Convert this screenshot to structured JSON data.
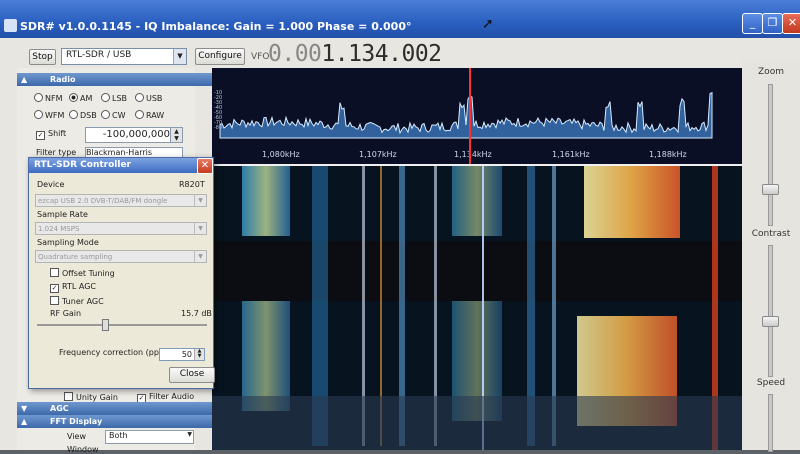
{
  "window": {
    "title": "SDR# v1.0.0.1145 - IQ Imbalance: Gain = 1.000 Phase = 0.000°",
    "controls": [
      "_",
      "❐",
      "✕"
    ]
  },
  "toolbar": {
    "stop_label": "Stop",
    "source_selected": "RTL-SDR / USB",
    "configure_label": "Configure",
    "vfo_label": "VFO",
    "vfo_value_dim": "0.00",
    "vfo_value": "1.134.002"
  },
  "radio": {
    "section_title": "Radio",
    "modes": [
      {
        "label": "NFM",
        "selected": false
      },
      {
        "label": "AM",
        "selected": true
      },
      {
        "label": "LSB",
        "selected": false
      },
      {
        "label": "USB",
        "selected": false
      },
      {
        "label": "WFM",
        "selected": false
      },
      {
        "label": "DSB",
        "selected": false
      },
      {
        "label": "CW",
        "selected": false
      },
      {
        "label": "RAW",
        "selected": false
      }
    ],
    "shift_label": "Shift",
    "shift_checked": true,
    "shift_value": "-100,000,000",
    "filter_type_label": "Filter type",
    "filter_type_value": "Blackman-Harris"
  },
  "audio": {
    "unity_gain_label": "Unity Gain",
    "filter_audio_label": "Filter Audio",
    "filter_audio_checked": true
  },
  "agc": {
    "section_title": "AGC"
  },
  "fft": {
    "section_title": "FFT Display",
    "view_label": "View",
    "view_value": "Both",
    "window_label": "Window"
  },
  "spectrum": {
    "db_ticks": [
      "-10",
      "-20",
      "-30",
      "-40",
      "-50",
      "-60",
      "-70",
      "-80"
    ],
    "freq_ticks": [
      "1,080kHz",
      "1,107kHz",
      "1,134kHz",
      "1,161kHz",
      "1,188kHz"
    ]
  },
  "right_panel": {
    "zoom_label": "Zoom",
    "contrast_label": "Contrast",
    "speed_label": "Speed"
  },
  "dialog": {
    "title": "RTL-SDR Controller",
    "device_label": "Device",
    "device_tuner": "R820T",
    "device_value": "ezcap USB 2.0 DVB-T/DAB/FM dongle",
    "sample_rate_label": "Sample Rate",
    "sample_rate_value": "1.024 MSPS",
    "sampling_mode_label": "Sampling Mode",
    "sampling_mode_value": "Quadrature sampling",
    "offset_tuning_label": "Offset Tuning",
    "offset_tuning_checked": false,
    "rtl_agc_label": "RTL AGC",
    "rtl_agc_checked": true,
    "tuner_agc_label": "Tuner AGC",
    "tuner_agc_checked": false,
    "rf_gain_label": "RF Gain",
    "rf_gain_value": "15.7 dB",
    "freq_correction_label": "Frequency correction (ppm)",
    "freq_correction_value": "50",
    "close_label": "Close"
  },
  "colors": {
    "titlebar": "#2a5fc0",
    "vfo_marker": "#ff3030",
    "spectrum_bg": "#0b0f26",
    "spectrum_fill": "#4a86c8"
  }
}
